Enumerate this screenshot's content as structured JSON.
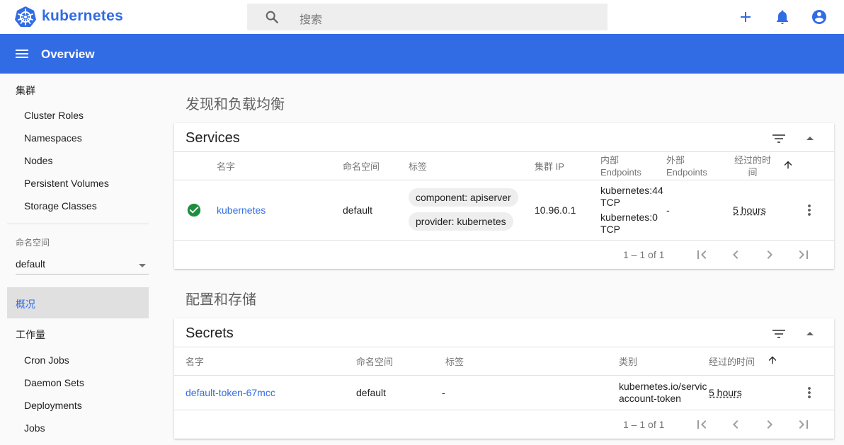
{
  "app": {
    "brand": "kubernetes",
    "search_placeholder": "搜索",
    "page_title": "Overview",
    "colors": {
      "brand": "#326ce5",
      "success": "#1e8e3e"
    }
  },
  "sidebar": {
    "cluster_section": "集群",
    "cluster_items": [
      "Cluster Roles",
      "Namespaces",
      "Nodes",
      "Persistent Volumes",
      "Storage Classes"
    ],
    "namespace_label": "命名空间",
    "namespace_value": "default",
    "overview": "概况",
    "workloads_section": "工作量",
    "workload_items": [
      "Cron Jobs",
      "Daemon Sets",
      "Deployments",
      "Jobs"
    ]
  },
  "main": {
    "discovery_title": "发现和负载均衡",
    "config_title": "配置和存储"
  },
  "services": {
    "title": "Services",
    "headers": {
      "name": "名字",
      "namespace": "命名空间",
      "labels": "标签",
      "cluster_ip": "集群 IP",
      "internal_1": "内部",
      "internal_2": "Endpoints",
      "external_1": "外部",
      "external_2": "Endpoints",
      "age_1": "经过的时",
      "age_2": "间"
    },
    "row": {
      "name": "kubernetes",
      "namespace": "default",
      "labels": [
        "component: apiserver",
        "provider: kubernetes"
      ],
      "cluster_ip": "10.96.0.1",
      "internal_ep": [
        "kubernetes:44",
        "TCP",
        "kubernetes:0",
        "TCP"
      ],
      "external_ep": "-",
      "age": "5 hours"
    },
    "pager": "1 – 1 of 1"
  },
  "secrets": {
    "title": "Secrets",
    "headers": {
      "name": "名字",
      "namespace": "命名空间",
      "labels": "标签",
      "type": "类别",
      "age": "经过的时间"
    },
    "row": {
      "name": "default-token-67mcc",
      "namespace": "default",
      "labels": "-",
      "type_1": "kubernetes.io/service",
      "type_2": "account-token",
      "age": "5 hours"
    },
    "pager": "1 – 1 of 1"
  }
}
